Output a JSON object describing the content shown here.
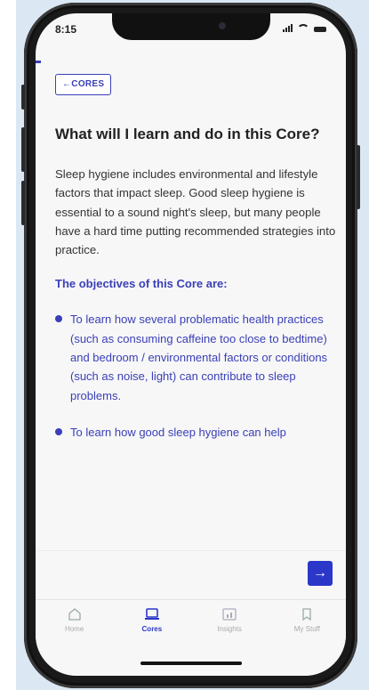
{
  "status_bar": {
    "time": "8:15"
  },
  "back_button": {
    "label": "←CORES"
  },
  "heading": "What will I learn and do in this Core?",
  "intro": "Sleep hygiene includes environmental and lifestyle factors that impact sleep. Good sleep hygiene is essential to a sound night's sleep, but many people have a hard time putting recommended strategies into practice.",
  "objectives_title": "The objectives of this Core are:",
  "objectives": [
    "To learn how several problematic health practices (such as consuming caffeine too close to bedtime) and bedroom / environmental factors or conditions (such as noise, light) can contribute to sleep problems.",
    "To learn how good sleep hygiene can help"
  ],
  "next_button": {
    "icon": "arrow-right-icon",
    "label": "→"
  },
  "tabs": [
    {
      "label": "Home",
      "icon": "home-icon"
    },
    {
      "label": "Cores",
      "icon": "laptop-icon",
      "active": true
    },
    {
      "label": "Insights",
      "icon": "chart-icon"
    },
    {
      "label": "My Stuff",
      "icon": "bookmark-icon"
    }
  ],
  "colors": {
    "accent": "#3a3fb8",
    "button": "#2b37c9"
  }
}
